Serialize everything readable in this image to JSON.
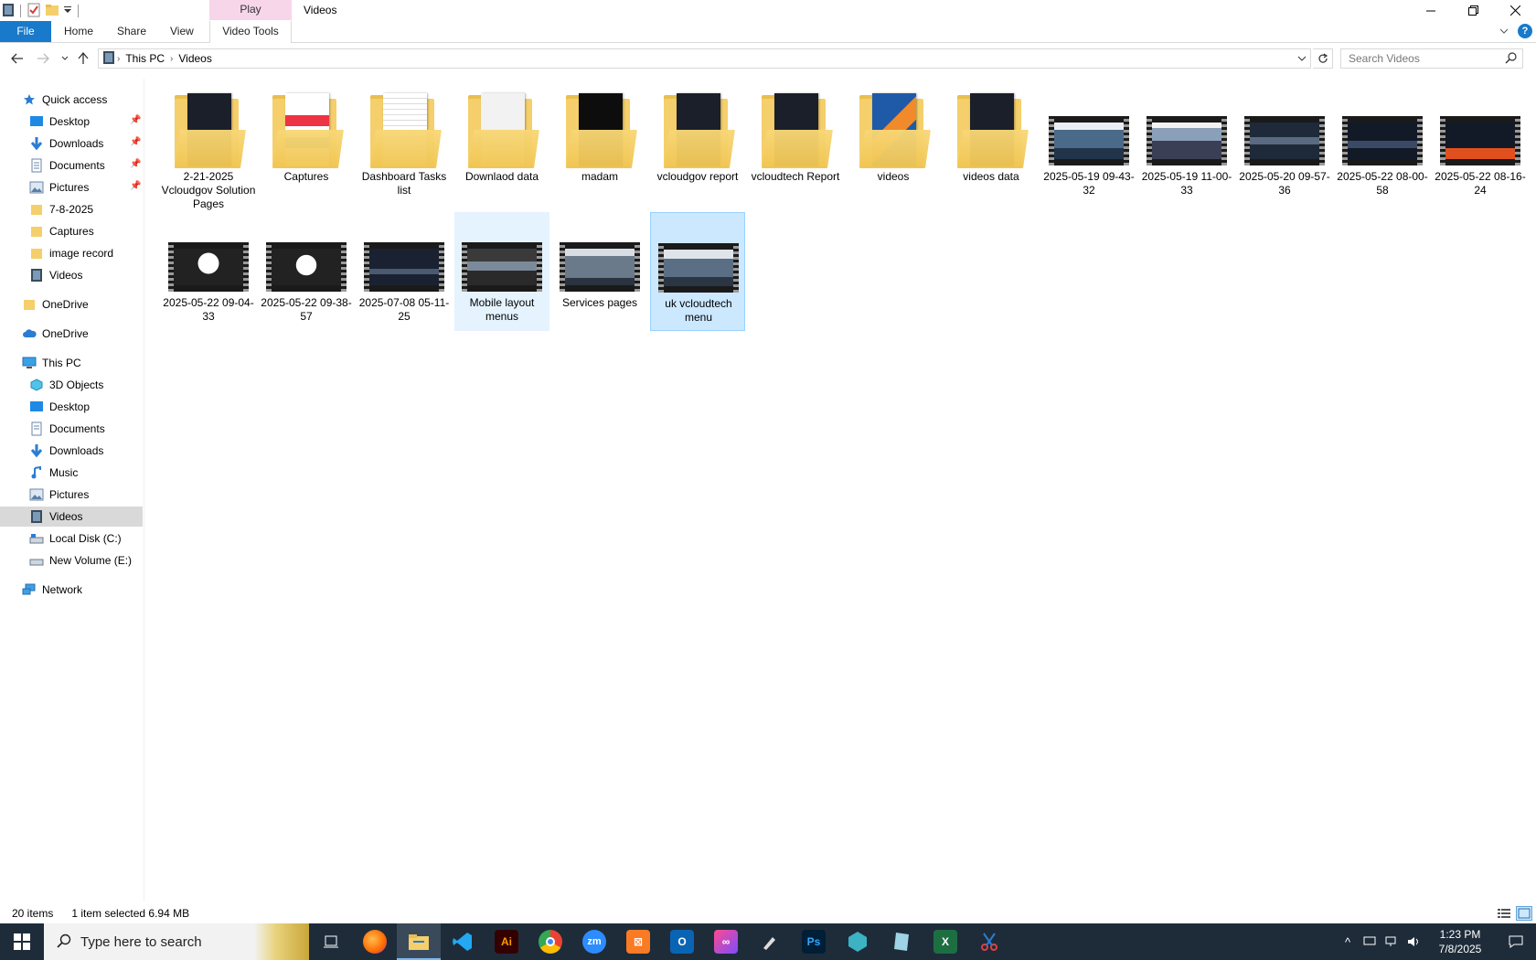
{
  "window": {
    "title": "Videos",
    "context_tab_title": "Play"
  },
  "ribbon": {
    "file": "File",
    "home": "Home",
    "share": "Share",
    "view": "View",
    "video_tools": "Video Tools"
  },
  "address": {
    "crumbs": [
      "This PC",
      "Videos"
    ]
  },
  "search": {
    "placeholder": "Search Videos"
  },
  "nav": {
    "quick_access": "Quick access",
    "qa_items": [
      "Desktop",
      "Downloads",
      "Documents",
      "Pictures",
      "7-8-2025",
      "Captures",
      "image record",
      "Videos"
    ],
    "onedrive1": "OneDrive",
    "onedrive2": "OneDrive",
    "this_pc": "This PC",
    "pc_items": [
      "3D Objects",
      "Desktop",
      "Documents",
      "Downloads",
      "Music",
      "Pictures",
      "Videos",
      "Local Disk (C:)",
      "New Volume (E:)"
    ],
    "network": "Network"
  },
  "items": [
    {
      "label": "2-21-2025 Vcloudgov Solution Pages",
      "kind": "folder"
    },
    {
      "label": "Captures",
      "kind": "folder"
    },
    {
      "label": "Dashboard Tasks list",
      "kind": "folder"
    },
    {
      "label": "Downlaod data",
      "kind": "folder"
    },
    {
      "label": "madam",
      "kind": "folder"
    },
    {
      "label": "vcloudgov report",
      "kind": "folder"
    },
    {
      "label": "vcloudtech Report",
      "kind": "folder"
    },
    {
      "label": "videos",
      "kind": "folder"
    },
    {
      "label": "videos data",
      "kind": "folder"
    },
    {
      "label": "2025-05-19 09-43-32",
      "kind": "video"
    },
    {
      "label": "2025-05-19 11-00-33",
      "kind": "video"
    },
    {
      "label": "2025-05-20 09-57-36",
      "kind": "video"
    },
    {
      "label": "2025-05-22 08-00-58",
      "kind": "video"
    },
    {
      "label": "2025-05-22 08-16-24",
      "kind": "video"
    },
    {
      "label": "2025-05-22 09-04-33",
      "kind": "video"
    },
    {
      "label": "2025-05-22 09-38-57",
      "kind": "video"
    },
    {
      "label": "2025-07-08 05-11-25",
      "kind": "video"
    },
    {
      "label": "Mobile layout menus",
      "kind": "video",
      "state": "hover"
    },
    {
      "label": "Services pages",
      "kind": "video"
    },
    {
      "label": "uk vcloudtech menu",
      "kind": "video",
      "state": "selected"
    }
  ],
  "status": {
    "count": "20 items",
    "selection": "1 item selected  6.94 MB"
  },
  "taskbar": {
    "search_placeholder": "Type here to search",
    "time": "1:23 PM",
    "date": "7/8/2025",
    "apps": [
      "task-view",
      "firefox",
      "file-explorer",
      "vscode",
      "illustrator",
      "chrome",
      "zoom",
      "xampp",
      "outlook",
      "creative-cloud",
      "pen-tool",
      "photoshop",
      "app-hex",
      "app-paper",
      "excel",
      "snip-tool"
    ]
  },
  "colors": {
    "accent": "#1979ca",
    "selected_bg": "#cce8ff",
    "hover_bg": "#e5f3ff",
    "taskbar": "#1e2c3a"
  }
}
